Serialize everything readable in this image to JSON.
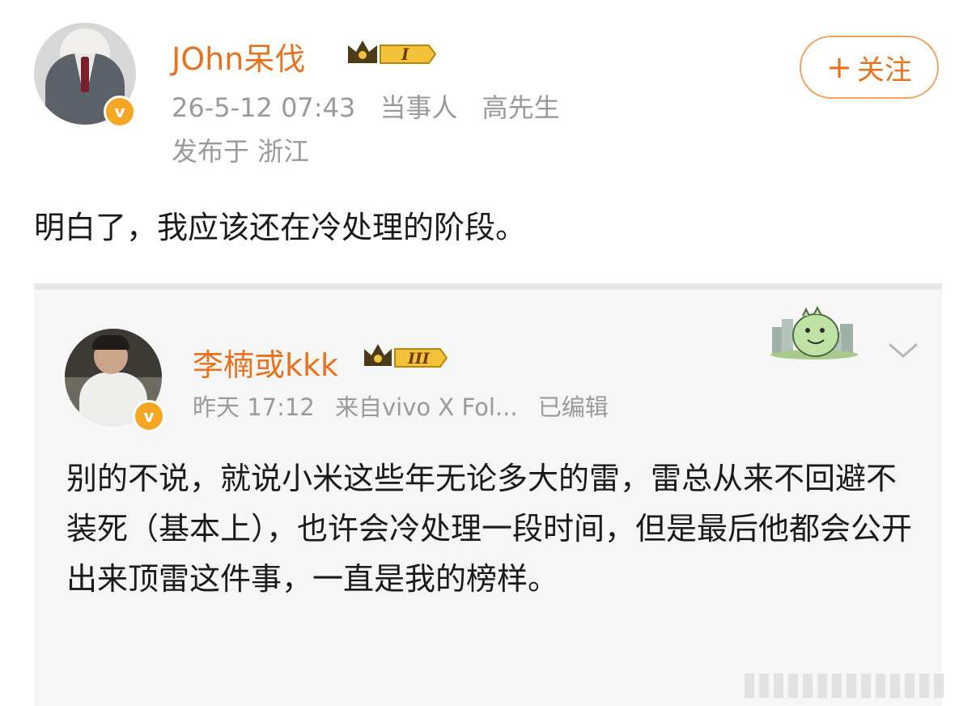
{
  "post": {
    "author": "JOhn呆伐",
    "level_badge": "I",
    "date": "26-5-12 07:43",
    "tag_label": "当事人",
    "tag_value": "高先生",
    "location": "发布于 浙江",
    "text": "明白了，我应该还在冷处理的阶段。",
    "follow_label": "关注"
  },
  "quoted": {
    "author": "李楠或kkk",
    "level_badge": "III",
    "time": "昨天 17:12",
    "source": "来自vivo X Fol...",
    "edited": "已编辑",
    "text": "别的不说，就说小米这些年无论多大的雷，雷总从来不回避不装死（基本上），也许会冷处理一段时间，但是最后他都会公开出来顶雷这件事，一直是我的榜样。"
  },
  "colors": {
    "accent": "#e8731c",
    "meta_gray": "#9a9a9a",
    "verified_badge": "#f5a623",
    "card_bg": "#f6f6f6"
  },
  "icons": {
    "verified": "v-verified-icon",
    "crown": "crown-level-icon",
    "plus": "plus-icon",
    "more": "chevron-down-icon",
    "sticker": "dinosaur-sticker-icon"
  }
}
